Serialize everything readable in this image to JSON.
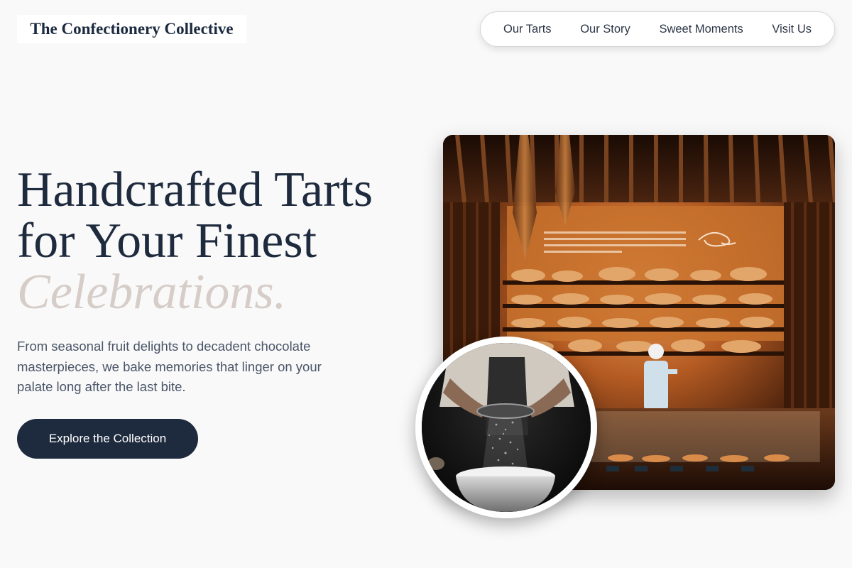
{
  "brand": {
    "name": "The Confectionery Collective"
  },
  "nav": {
    "items": [
      {
        "label": "Our Tarts"
      },
      {
        "label": "Our Story"
      },
      {
        "label": "Sweet Moments"
      },
      {
        "label": "Visit Us"
      }
    ]
  },
  "hero": {
    "title_line1": "Handcrafted Tarts",
    "title_line2": "for Your Finest",
    "title_accent": "Celebrations.",
    "description": "From seasonal fruit delights to decadent chocolate masterpieces, we bake memories that linger on your palate long after the last bite.",
    "cta_label": "Explore the Collection"
  },
  "images": {
    "main": {
      "depicts": "bakery-interior-with-baker"
    },
    "circle": {
      "depicts": "hands-sifting-flour"
    }
  },
  "colors": {
    "background": "#f9f9f9",
    "primary_dark": "#1e2a3e",
    "accent_muted": "#d6cdc8",
    "body_text": "#4a5568"
  }
}
